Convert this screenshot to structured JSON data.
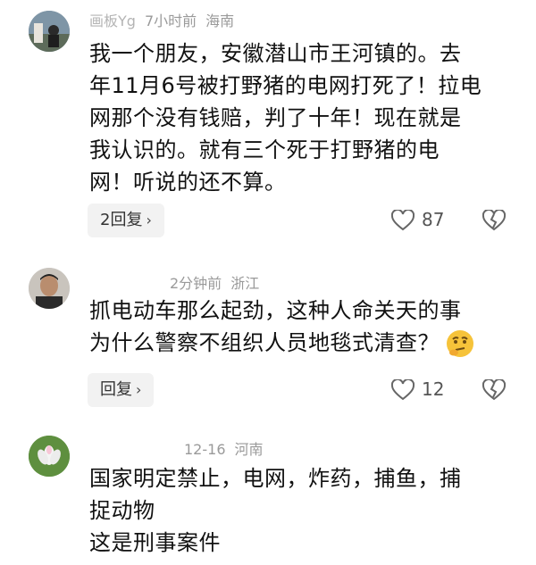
{
  "comments": [
    {
      "username": "画板Yg",
      "time": "7小时前",
      "location": "海南",
      "lines": [
        "我一个朋友，安徽潜山市王河镇的。去",
        "年11月6号被打野猪的电网打死了！拉电",
        "网那个没有钱赔，判了十年！现在就是",
        "我认识的。就有三个死于打野猪的电",
        "网！听说的还不算。"
      ],
      "reply_label": "2回复",
      "likes": "87"
    },
    {
      "username": "",
      "time": "2分钟前",
      "location": "浙江",
      "lines": [
        "抓电动车那么起劲，这种人命关天的事",
        "为什么警察不组织人员地毯式清查？"
      ],
      "reply_label": "回复",
      "likes": "12"
    },
    {
      "username": "",
      "time": "12-16",
      "location": "河南",
      "lines": [
        "国家明定禁止，电网，炸药，捕鱼，捕",
        "捉动物",
        "这是刑事案件"
      ]
    }
  ],
  "icons": {
    "chevron": "›",
    "like": "heart-outline-icon",
    "dislike": "broken-heart-icon"
  }
}
